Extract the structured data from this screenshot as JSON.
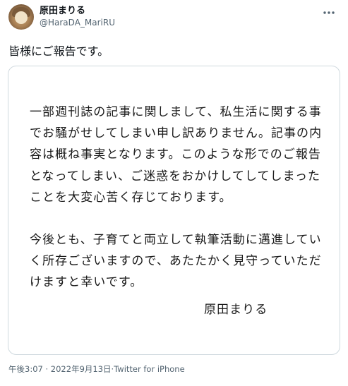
{
  "author": {
    "display_name": "原田まりる",
    "handle": "@HaraDA_MariRU"
  },
  "tweet": {
    "text": "皆様にご報告です。"
  },
  "statement": {
    "paragraph1": "一部週刊誌の記事に関しまして、私生活に関する事でお騒がせしてしまい申し訳ありません。記事の内容は概ね事実となります。このような形でのご報告となってしまい、ご迷惑をおかけしてしてしまったことを大変心苦く存じております。",
    "paragraph2": "今後とも、子育てと両立して執筆活動に邁進していく所存ございますので、あたたかく見守っていただけますと幸いです。",
    "signature": "原田まりる"
  },
  "meta": {
    "time": "午後3:07",
    "separator1": " · ",
    "date": "2022年9月13日",
    "separator2": "·",
    "source": "Twitter for iPhone"
  },
  "icons": {
    "more": "more-horizontal-icon",
    "avatar": "profile-avatar"
  },
  "colors": {
    "text": "#0f1419",
    "secondary": "#536471",
    "border": "#cfd9de"
  }
}
